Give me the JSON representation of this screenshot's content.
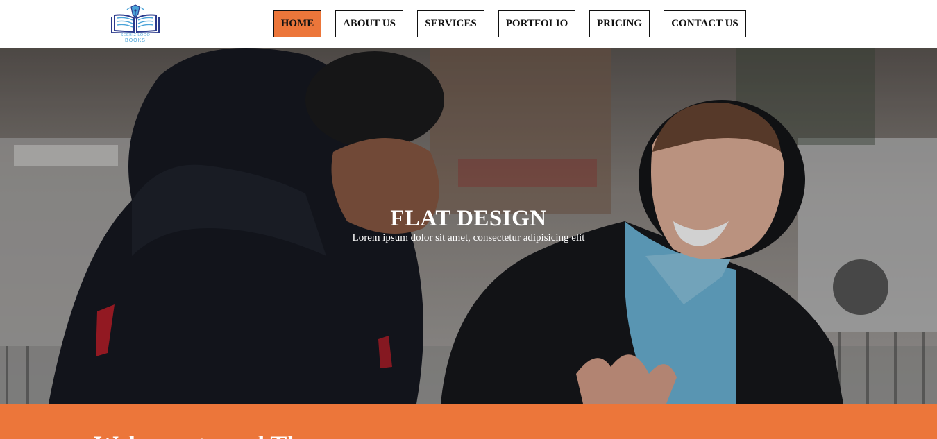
{
  "header": {
    "logo": {
      "icon": "open-book-pen-logo-icon",
      "line1": "SEEBIZ LOGO",
      "line2": "BOOKS"
    },
    "nav": [
      {
        "label": "HOME",
        "active": true
      },
      {
        "label": "ABOUT US",
        "active": false
      },
      {
        "label": "SERVICES",
        "active": false
      },
      {
        "label": "PORTFOLIO",
        "active": false
      },
      {
        "label": "PRICING",
        "active": false
      },
      {
        "label": "CONTACT US",
        "active": false
      }
    ]
  },
  "hero": {
    "title": "FLAT DESIGN",
    "subtitle": "Lorem ipsum dolor sit amet, consectetur adipisicing elit",
    "image": "two-young-men-talking-outdoors-winter-photo"
  },
  "welcome": {
    "title": "Welcome to and The"
  },
  "colors": {
    "accent": "#ec763a",
    "nav_border": "#111111",
    "text_light": "#ffffff"
  }
}
